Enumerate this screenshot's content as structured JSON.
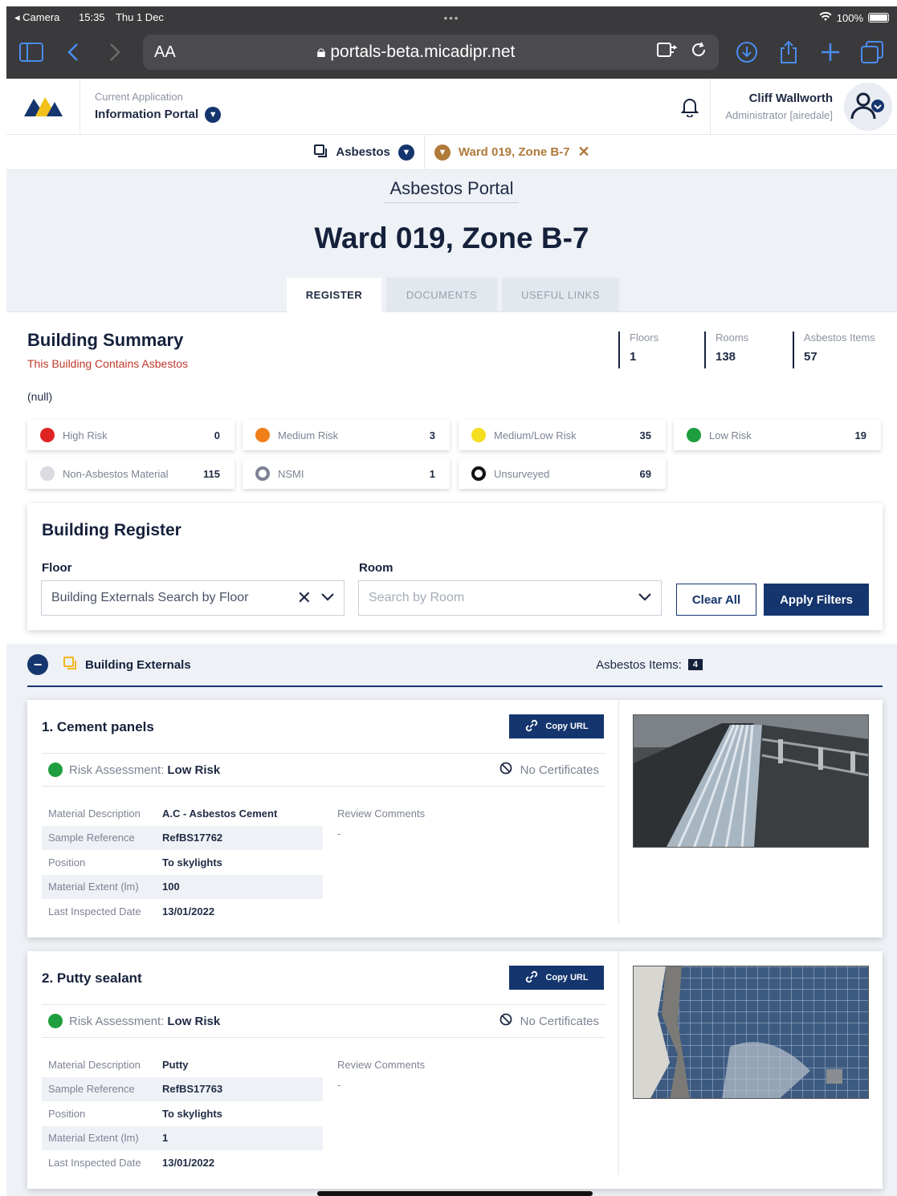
{
  "status_bar": {
    "back_app": "Camera",
    "time": "15:35",
    "date": "Thu 1 Dec",
    "battery": "100%"
  },
  "browser": {
    "aa_label": "AA",
    "url": "portals-beta.micadipr.net"
  },
  "app_header": {
    "current_app_label": "Current Application",
    "current_app": "Information Portal",
    "user_name": "Cliff Wallworth",
    "user_role": "Administrator [airedale]"
  },
  "breadcrumb": {
    "module": "Asbestos",
    "location": "Ward 019, Zone B-7"
  },
  "hero": {
    "portal_title": "Asbestos Portal",
    "page_title": "Ward 019, Zone B-7",
    "tabs": [
      "REGISTER",
      "DOCUMENTS",
      "USEFUL LINKS"
    ]
  },
  "summary": {
    "title": "Building Summary",
    "subtitle": "This Building Contains Asbestos",
    "note": "(null)",
    "stats": [
      {
        "label": "Floors",
        "value": "1"
      },
      {
        "label": "Rooms",
        "value": "138"
      },
      {
        "label": "Asbestos Items",
        "value": "57"
      }
    ],
    "risks": [
      {
        "label": "High Risk",
        "count": "0",
        "color": "#e02424"
      },
      {
        "label": "Medium Risk",
        "count": "3",
        "color": "#f07f1a"
      },
      {
        "label": "Medium/Low Risk",
        "count": "35",
        "color": "#f5dd1f"
      },
      {
        "label": "Low Risk",
        "count": "19",
        "color": "#1e9e3e"
      },
      {
        "label": "Non-Asbestos Material",
        "count": "115",
        "color": "#d9dbe0"
      },
      {
        "label": "NSMI",
        "count": "1",
        "color": "#7d8394"
      },
      {
        "label": "Unsurveyed",
        "count": "69",
        "color": "#111111"
      }
    ]
  },
  "register": {
    "title": "Building Register",
    "floor_label": "Floor",
    "floor_value": "Building Externals Search by Floor",
    "room_label": "Room",
    "room_placeholder": "Search by Room",
    "clear_label": "Clear All",
    "apply_label": "Apply Filters"
  },
  "externals": {
    "title": "Building Externals",
    "items_label": "Asbestos Items:",
    "items_count": "4",
    "items": [
      {
        "title": "1. Cement panels",
        "copy_label": "Copy URL",
        "risk_prefix": "Risk Assessment:",
        "risk_value": "Low Risk",
        "certificates": "No Certificates",
        "review_label": "Review Comments",
        "review_value": "-",
        "props": [
          {
            "k": "Material Description",
            "v": "A.C - Asbestos Cement"
          },
          {
            "k": "Sample Reference",
            "v": "RefBS17762"
          },
          {
            "k": "Position",
            "v": "To skylights"
          },
          {
            "k": "Material Extent (lm)",
            "v": "100"
          },
          {
            "k": "Last Inspected Date",
            "v": "13/01/2022"
          }
        ]
      },
      {
        "title": "2. Putty sealant",
        "copy_label": "Copy URL",
        "risk_prefix": "Risk Assessment:",
        "risk_value": "Low Risk",
        "certificates": "No Certificates",
        "review_label": "Review Comments",
        "review_value": "-",
        "props": [
          {
            "k": "Material Description",
            "v": "Putty"
          },
          {
            "k": "Sample Reference",
            "v": "RefBS17763"
          },
          {
            "k": "Position",
            "v": "To skylights"
          },
          {
            "k": "Material Extent (lm)",
            "v": "1"
          },
          {
            "k": "Last Inspected Date",
            "v": "13/01/2022"
          }
        ]
      }
    ]
  }
}
